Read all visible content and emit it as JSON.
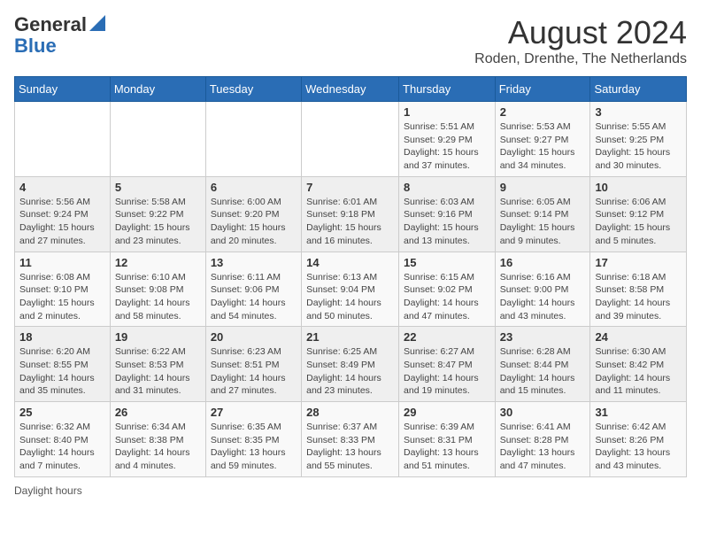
{
  "logo": {
    "line1": "General",
    "line2": "Blue"
  },
  "title": {
    "month_year": "August 2024",
    "location": "Roden, Drenthe, The Netherlands"
  },
  "days_of_week": [
    "Sunday",
    "Monday",
    "Tuesday",
    "Wednesday",
    "Thursday",
    "Friday",
    "Saturday"
  ],
  "footer": {
    "daylight_label": "Daylight hours"
  },
  "weeks": [
    {
      "days": [
        {
          "num": "",
          "info": ""
        },
        {
          "num": "",
          "info": ""
        },
        {
          "num": "",
          "info": ""
        },
        {
          "num": "",
          "info": ""
        },
        {
          "num": "1",
          "info": "Sunrise: 5:51 AM\nSunset: 9:29 PM\nDaylight: 15 hours\nand 37 minutes."
        },
        {
          "num": "2",
          "info": "Sunrise: 5:53 AM\nSunset: 9:27 PM\nDaylight: 15 hours\nand 34 minutes."
        },
        {
          "num": "3",
          "info": "Sunrise: 5:55 AM\nSunset: 9:25 PM\nDaylight: 15 hours\nand 30 minutes."
        }
      ]
    },
    {
      "days": [
        {
          "num": "4",
          "info": "Sunrise: 5:56 AM\nSunset: 9:24 PM\nDaylight: 15 hours\nand 27 minutes."
        },
        {
          "num": "5",
          "info": "Sunrise: 5:58 AM\nSunset: 9:22 PM\nDaylight: 15 hours\nand 23 minutes."
        },
        {
          "num": "6",
          "info": "Sunrise: 6:00 AM\nSunset: 9:20 PM\nDaylight: 15 hours\nand 20 minutes."
        },
        {
          "num": "7",
          "info": "Sunrise: 6:01 AM\nSunset: 9:18 PM\nDaylight: 15 hours\nand 16 minutes."
        },
        {
          "num": "8",
          "info": "Sunrise: 6:03 AM\nSunset: 9:16 PM\nDaylight: 15 hours\nand 13 minutes."
        },
        {
          "num": "9",
          "info": "Sunrise: 6:05 AM\nSunset: 9:14 PM\nDaylight: 15 hours\nand 9 minutes."
        },
        {
          "num": "10",
          "info": "Sunrise: 6:06 AM\nSunset: 9:12 PM\nDaylight: 15 hours\nand 5 minutes."
        }
      ]
    },
    {
      "days": [
        {
          "num": "11",
          "info": "Sunrise: 6:08 AM\nSunset: 9:10 PM\nDaylight: 15 hours\nand 2 minutes."
        },
        {
          "num": "12",
          "info": "Sunrise: 6:10 AM\nSunset: 9:08 PM\nDaylight: 14 hours\nand 58 minutes."
        },
        {
          "num": "13",
          "info": "Sunrise: 6:11 AM\nSunset: 9:06 PM\nDaylight: 14 hours\nand 54 minutes."
        },
        {
          "num": "14",
          "info": "Sunrise: 6:13 AM\nSunset: 9:04 PM\nDaylight: 14 hours\nand 50 minutes."
        },
        {
          "num": "15",
          "info": "Sunrise: 6:15 AM\nSunset: 9:02 PM\nDaylight: 14 hours\nand 47 minutes."
        },
        {
          "num": "16",
          "info": "Sunrise: 6:16 AM\nSunset: 9:00 PM\nDaylight: 14 hours\nand 43 minutes."
        },
        {
          "num": "17",
          "info": "Sunrise: 6:18 AM\nSunset: 8:58 PM\nDaylight: 14 hours\nand 39 minutes."
        }
      ]
    },
    {
      "days": [
        {
          "num": "18",
          "info": "Sunrise: 6:20 AM\nSunset: 8:55 PM\nDaylight: 14 hours\nand 35 minutes."
        },
        {
          "num": "19",
          "info": "Sunrise: 6:22 AM\nSunset: 8:53 PM\nDaylight: 14 hours\nand 31 minutes."
        },
        {
          "num": "20",
          "info": "Sunrise: 6:23 AM\nSunset: 8:51 PM\nDaylight: 14 hours\nand 27 minutes."
        },
        {
          "num": "21",
          "info": "Sunrise: 6:25 AM\nSunset: 8:49 PM\nDaylight: 14 hours\nand 23 minutes."
        },
        {
          "num": "22",
          "info": "Sunrise: 6:27 AM\nSunset: 8:47 PM\nDaylight: 14 hours\nand 19 minutes."
        },
        {
          "num": "23",
          "info": "Sunrise: 6:28 AM\nSunset: 8:44 PM\nDaylight: 14 hours\nand 15 minutes."
        },
        {
          "num": "24",
          "info": "Sunrise: 6:30 AM\nSunset: 8:42 PM\nDaylight: 14 hours\nand 11 minutes."
        }
      ]
    },
    {
      "days": [
        {
          "num": "25",
          "info": "Sunrise: 6:32 AM\nSunset: 8:40 PM\nDaylight: 14 hours\nand 7 minutes."
        },
        {
          "num": "26",
          "info": "Sunrise: 6:34 AM\nSunset: 8:38 PM\nDaylight: 14 hours\nand 4 minutes."
        },
        {
          "num": "27",
          "info": "Sunrise: 6:35 AM\nSunset: 8:35 PM\nDaylight: 13 hours\nand 59 minutes."
        },
        {
          "num": "28",
          "info": "Sunrise: 6:37 AM\nSunset: 8:33 PM\nDaylight: 13 hours\nand 55 minutes."
        },
        {
          "num": "29",
          "info": "Sunrise: 6:39 AM\nSunset: 8:31 PM\nDaylight: 13 hours\nand 51 minutes."
        },
        {
          "num": "30",
          "info": "Sunrise: 6:41 AM\nSunset: 8:28 PM\nDaylight: 13 hours\nand 47 minutes."
        },
        {
          "num": "31",
          "info": "Sunrise: 6:42 AM\nSunset: 8:26 PM\nDaylight: 13 hours\nand 43 minutes."
        }
      ]
    }
  ]
}
